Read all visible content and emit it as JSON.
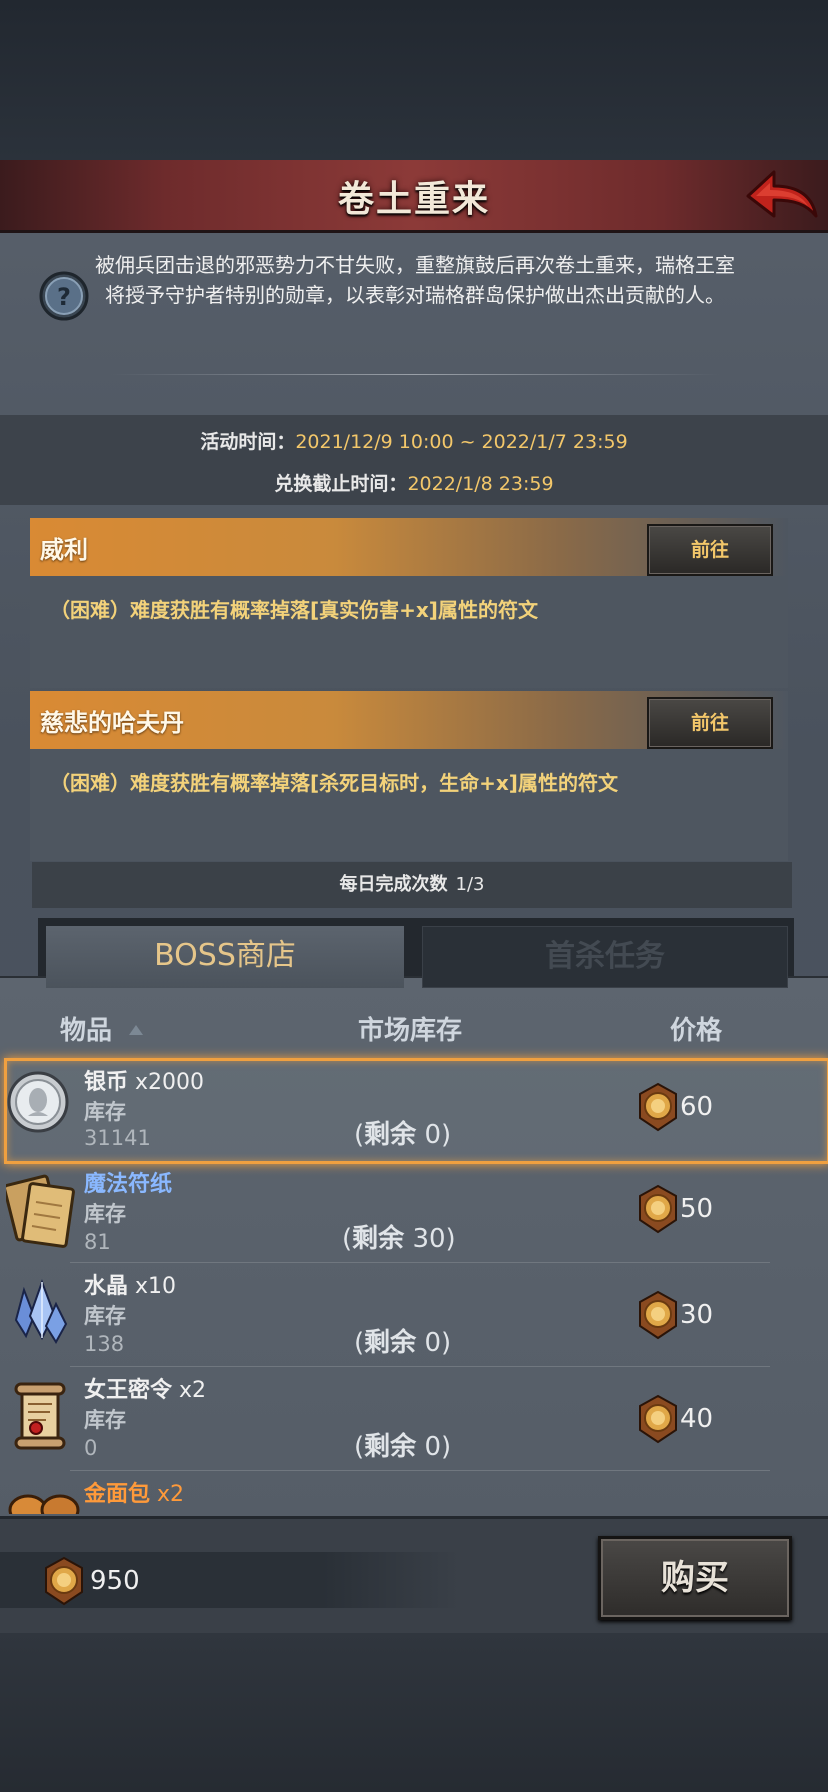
{
  "header": {
    "title": "卷土重来"
  },
  "intro": {
    "description": "被佣兵团击退的邪恶势力不甘失败，重整旗鼓后再次卷土重来，瑞格王室将授予守护者特别的勋章，以表彰对瑞格群岛保护做出杰出贡献的人。"
  },
  "event_time": {
    "label": "活动时间：",
    "value": "2021/12/9 10:00 ~ 2022/1/7 23:59",
    "exchange_label": "兑换截止时间：",
    "exchange_value": "2022/1/8 23:59"
  },
  "bosses": [
    {
      "name": "威利",
      "button": "前往",
      "desc": "（困难）难度获胜有概率掉落[真实伤害+x]属性的符文"
    },
    {
      "name": "慈悲的哈夫丹",
      "button": "前往",
      "desc": "（困难）难度获胜有概率掉落[杀死目标时，生命+x]属性的符文"
    }
  ],
  "daily": {
    "label": "每日完成次数",
    "count": "1/3"
  },
  "tabs": [
    {
      "label": "BOSS商店",
      "active": true
    },
    {
      "label": "首杀任务",
      "active": false
    }
  ],
  "columns": {
    "item": "物品",
    "stock": "市场库存",
    "price": "价格"
  },
  "items": [
    {
      "name": "银币",
      "qty": " x2000",
      "stock_label": "库存",
      "stock": "31141",
      "remain_label": "剩余",
      "remain": "0",
      "price": "60",
      "icon": "silver-coin-icon",
      "selected": true
    },
    {
      "name": "魔法符纸",
      "qty": "",
      "stock_label": "库存",
      "stock": "81",
      "remain_label": "剩余",
      "remain": "30",
      "price": "50",
      "icon": "magic-paper-icon",
      "selected": false
    },
    {
      "name": "水晶",
      "qty": " x10",
      "stock_label": "库存",
      "stock": "138",
      "remain_label": "剩余",
      "remain": "0",
      "price": "30",
      "icon": "crystal-icon",
      "selected": false
    },
    {
      "name": "女王密令",
      "qty": " x2",
      "stock_label": "库存",
      "stock": "0",
      "remain_label": "剩余",
      "remain": "0",
      "price": "40",
      "icon": "scroll-icon",
      "selected": false
    },
    {
      "name": "金面包",
      "qty": " x2",
      "icon": "bread-icon"
    }
  ],
  "footer": {
    "currency": "950",
    "buy_label": "购买"
  },
  "colors": {
    "accent": "#f3c76a",
    "selection": "#f0a040",
    "boss_header": "#d98a34",
    "header_bar": "#8c3a38"
  }
}
